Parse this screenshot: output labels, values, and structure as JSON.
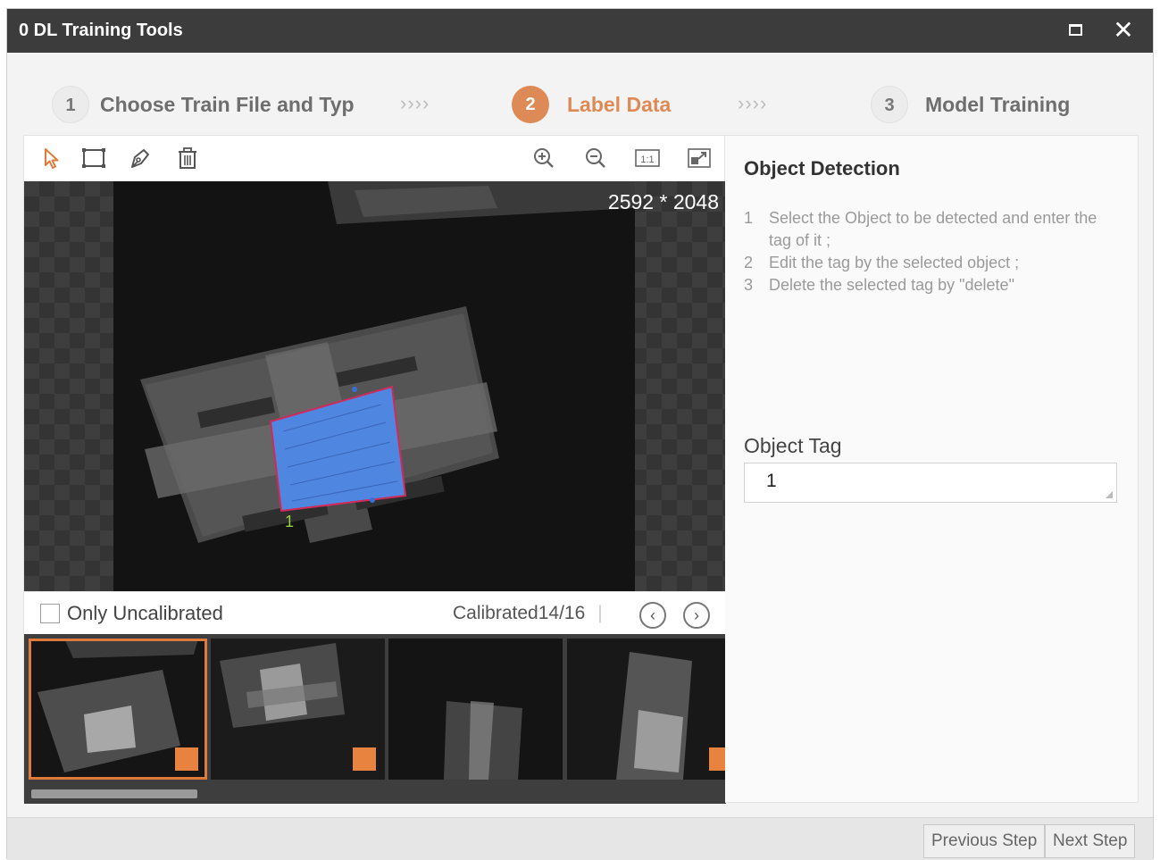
{
  "window": {
    "title": "0 DL Training Tools"
  },
  "steps": [
    {
      "number": "1",
      "label": "Choose Train File and Typ"
    },
    {
      "number": "2",
      "label": "Label Data"
    },
    {
      "number": "3",
      "label": "Model Training"
    }
  ],
  "step_separator": "››››",
  "toolbar": {
    "tools": [
      "pointer-icon",
      "rectangle-icon",
      "pen-icon",
      "trash-icon"
    ],
    "view_tools": [
      "zoom-in-icon",
      "zoom-out-icon",
      "actual-size-icon",
      "fit-window-icon"
    ],
    "actual_size_label": "1:1"
  },
  "canvas": {
    "resolution": "2592 * 2048",
    "label_number": "1",
    "box_color": "#4f86e0",
    "box_border_color": "#d02a5a"
  },
  "calibration": {
    "only_uncalibrated_label": "Only Uncalibrated",
    "count_label": "Calibrated14/16",
    "separator": "|",
    "prev": "‹",
    "next": "›"
  },
  "right_panel": {
    "title": "Object Detection",
    "instructions": [
      {
        "num": "1",
        "text": "Select the Object to be detected and enter the tag of it ;"
      },
      {
        "num": "2",
        "text": "Edit the tag by the selected object ;"
      },
      {
        "num": "3",
        "text": "Delete the selected tag by \"delete\""
      }
    ],
    "tag_label": "Object Tag",
    "tag_value": "1"
  },
  "footer": {
    "previous_label": "Previous Step",
    "next_label": "Next Step"
  },
  "colors": {
    "accent": "#de8a57",
    "titlebar": "#3c3c3c"
  }
}
